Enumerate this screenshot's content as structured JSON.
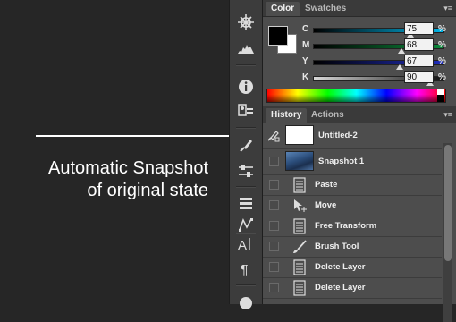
{
  "annotation": {
    "line1": "Automatic Snapshot",
    "line2": "of original state"
  },
  "color_panel": {
    "tabs": [
      "Color",
      "Swatches"
    ],
    "active_tab": "Color",
    "foreground_color": "#000000",
    "background_color": "#ffffff",
    "channels": [
      {
        "label": "C",
        "value": "75",
        "unit": "%",
        "fraction": 0.75
      },
      {
        "label": "M",
        "value": "68",
        "unit": "%",
        "fraction": 0.68
      },
      {
        "label": "Y",
        "value": "67",
        "unit": "%",
        "fraction": 0.67
      },
      {
        "label": "K",
        "value": "90",
        "unit": "%",
        "fraction": 0.9
      }
    ]
  },
  "history_panel": {
    "tabs": [
      "History",
      "Actions"
    ],
    "active_tab": "History",
    "snapshots": [
      {
        "label": "Untitled-2",
        "selected": true
      },
      {
        "label": "Snapshot 1",
        "selected": false
      }
    ],
    "states": [
      "Paste",
      "Move",
      "Free Transform",
      "Brush Tool",
      "Delete Layer",
      "Delete Layer"
    ]
  }
}
